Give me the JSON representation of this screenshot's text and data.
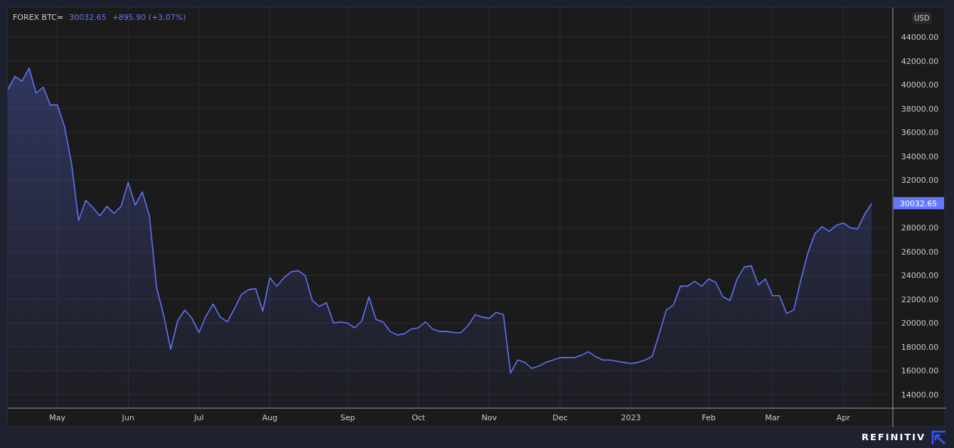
{
  "legend": {
    "price": "30032.65",
    "change": "+895.90 (+3.07%)"
  },
  "currency_button": "USD",
  "last_price_label": "30032.65",
  "chart_data": {
    "type": "area",
    "grid": true,
    "ylim": [
      12860,
      46450
    ],
    "categories": [
      null,
      null,
      null,
      null,
      null,
      null,
      null,
      "May",
      null,
      null,
      null,
      null,
      null,
      null,
      null,
      null,
      null,
      "Jun",
      null,
      null,
      null,
      null,
      null,
      null,
      null,
      null,
      null,
      "Jul",
      null,
      null,
      null,
      null,
      null,
      null,
      null,
      null,
      null,
      "Aug",
      null,
      null,
      null,
      null,
      null,
      null,
      null,
      null,
      null,
      null,
      "Sep",
      null,
      null,
      null,
      null,
      null,
      null,
      null,
      null,
      null,
      "Oct",
      null,
      null,
      null,
      null,
      null,
      null,
      null,
      null,
      null,
      "Nov",
      null,
      null,
      null,
      null,
      null,
      null,
      null,
      null,
      null,
      "Dec",
      null,
      null,
      null,
      null,
      null,
      null,
      null,
      null,
      null,
      "2023",
      null,
      null,
      null,
      null,
      null,
      null,
      null,
      null,
      null,
      null,
      "Feb",
      null,
      null,
      null,
      null,
      null,
      null,
      null,
      null,
      "Mar",
      null,
      null,
      null,
      null,
      null,
      null,
      null,
      null,
      null,
      "Apr",
      null,
      null,
      null,
      null
    ],
    "series": [
      {
        "name": "FOREX BTC=",
        "color": "#5f72f5",
        "values": [
          39600,
          40700,
          40300,
          41400,
          39300,
          39800,
          38300,
          38300,
          36500,
          33400,
          28600,
          30300,
          29700,
          29000,
          29800,
          29200,
          29800,
          31800,
          29900,
          31000,
          29000,
          23000,
          20700,
          17800,
          20200,
          21100,
          20400,
          19200,
          20600,
          21600,
          20500,
          20100,
          21200,
          22400,
          22800,
          22900,
          21000,
          23800,
          23100,
          23800,
          24300,
          24400,
          24000,
          21900,
          21400,
          21700,
          20000,
          20100,
          20000,
          19600,
          20200,
          22200,
          20300,
          20100,
          19300,
          19000,
          19100,
          19500,
          19600,
          20100,
          19500,
          19300,
          19300,
          19200,
          19200,
          19800,
          20700,
          20500,
          20400,
          20900,
          20700,
          15800,
          16900,
          16700,
          16200,
          16400,
          16700,
          16900,
          17100,
          17100,
          17100,
          17300,
          17600,
          17200,
          16900,
          16900,
          16800,
          16700,
          16600,
          16700,
          16900,
          17200,
          19100,
          21100,
          21500,
          23100,
          23100,
          23500,
          23100,
          23700,
          23400,
          22200,
          21900,
          23700,
          24700,
          24800,
          23200,
          23700,
          22300,
          22300,
          20800,
          21100,
          23600,
          25900,
          27500,
          28100,
          27700,
          28200,
          28400,
          28000,
          27900,
          29100,
          30030
        ]
      }
    ],
    "yticks": [
      {
        "value": 14000,
        "label": "14000.00"
      },
      {
        "value": 16000,
        "label": "16000.00"
      },
      {
        "value": 18000,
        "label": "18000.00"
      },
      {
        "value": 20000,
        "label": "20000.00"
      },
      {
        "value": 22000,
        "label": "22000.00"
      },
      {
        "value": 24000,
        "label": "24000.00"
      },
      {
        "value": 26000,
        "label": "26000.00"
      },
      {
        "value": 28000,
        "label": "28000.00"
      },
      {
        "value": 32000,
        "label": "32000.00"
      },
      {
        "value": 34000,
        "label": "34000.00"
      },
      {
        "value": 36000,
        "label": "36000.00"
      },
      {
        "value": 38000,
        "label": "38000.00"
      },
      {
        "value": 40000,
        "label": "40000.00"
      },
      {
        "value": 42000,
        "label": "42000.00"
      },
      {
        "value": 44000,
        "label": "44000.00"
      }
    ]
  },
  "brand": "REFINITIV"
}
